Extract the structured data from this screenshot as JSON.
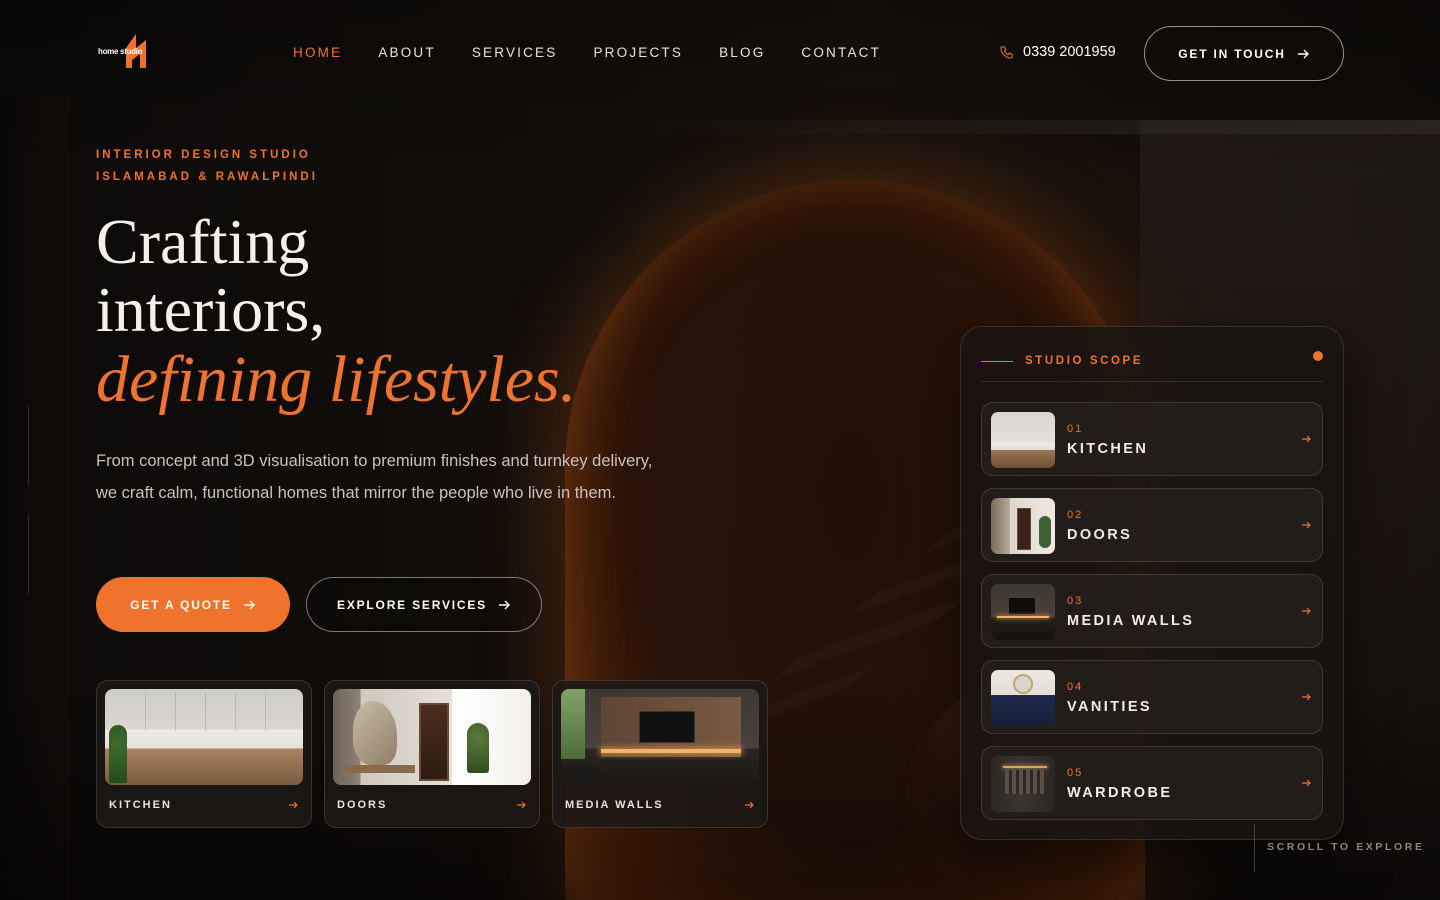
{
  "brand": {
    "logo_text": "home studio"
  },
  "nav": {
    "items": [
      {
        "label": "HOME",
        "active": true
      },
      {
        "label": "ABOUT",
        "active": false
      },
      {
        "label": "SERVICES",
        "active": false
      },
      {
        "label": "PROJECTS",
        "active": false
      },
      {
        "label": "BLOG",
        "active": false
      },
      {
        "label": "CONTACT",
        "active": false
      }
    ]
  },
  "header": {
    "phone": "0339 2001959",
    "cta_label": "GET IN TOUCH"
  },
  "hero": {
    "eyebrow_line1": "INTERIOR DESIGN STUDIO",
    "eyebrow_line2": "ISLAMABAD & RAWALPINDI",
    "headline_line1": "Crafting",
    "headline_line2": "interiors,",
    "headline_accent": "defining lifestyles.",
    "lead": "From concept and 3D visualisation to premium finishes and turnkey delivery, we craft calm, functional homes that mirror the people who live in them.",
    "primary_cta": "GET A QUOTE",
    "secondary_cta": "EXPLORE SERVICES"
  },
  "feature_cards": [
    {
      "label": "KITCHEN",
      "image": "kitchen-photo"
    },
    {
      "label": "DOORS",
      "image": "doors-photo"
    },
    {
      "label": "MEDIA WALLS",
      "image": "media-walls-photo"
    }
  ],
  "scope": {
    "title": "STUDIO SCOPE",
    "items": [
      {
        "num": "01",
        "name": "KITCHEN",
        "image": "kitchen-thumb"
      },
      {
        "num": "02",
        "name": "DOORS",
        "image": "doors-thumb"
      },
      {
        "num": "03",
        "name": "MEDIA WALLS",
        "image": "media-walls-thumb"
      },
      {
        "num": "04",
        "name": "VANITIES",
        "image": "vanities-thumb"
      },
      {
        "num": "05",
        "name": "WARDROBE",
        "image": "wardrobe-thumb"
      }
    ]
  },
  "scroll_hint": "SCROLL TO EXPLORE",
  "colors": {
    "accent": "#f0732d",
    "background": "#0e0b09",
    "text": "#f2ece6",
    "muted_text": "#c9c2bb"
  },
  "icons": {
    "phone": "phone-icon",
    "arrow": "arrow-right-icon"
  }
}
